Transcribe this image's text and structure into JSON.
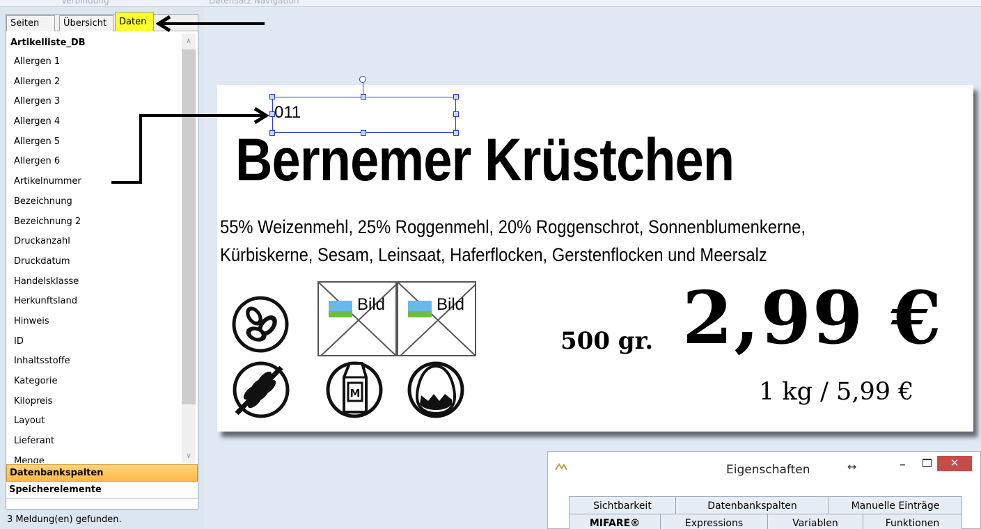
{
  "left_panel": {
    "tabs": [
      "Seiten",
      "Übersicht",
      "Daten"
    ],
    "database": "Artikelliste_DB",
    "fields": [
      "Allergen 1",
      "Allergen 2",
      "Allergen 3",
      "Allergen 4",
      "Allergen 5",
      "Allergen 6",
      "Artikelnummer",
      "Bezeichnung",
      "Bezeichnung 2",
      "Druckanzahl",
      "Druckdatum",
      "Handelsklasse",
      "Herkunftsland",
      "Hinweis",
      "ID",
      "Inhaltsstoffe",
      "Kategorie",
      "Kilopreis",
      "Layout",
      "Lieferant",
      "Menge"
    ],
    "sections": [
      "Datenbankspalten",
      "Speicherelemente"
    ]
  },
  "status": "3 Meldung(en) gefunden.",
  "label": {
    "article_number": "011",
    "product_name": "Bernemer Krüstchen",
    "ingredients_line1": "55% Weizenmehl, 25% Roggenmehl, 20% Roggenschrot, Sonnenblumenkerne,",
    "ingredients_line2": "Kürbiskerne, Sesam, Leinsaat, Haferflocken, Gerstenflocken und Meersalz",
    "weight": "500 gr.",
    "price": "2,99 €",
    "kilo_price": "1 kg / 5,99 €",
    "placeholder_text": "Bild",
    "icons": [
      "seeds-icon",
      "gluten-icon",
      "milk-icon",
      "egg-icon"
    ]
  },
  "properties": {
    "title": "Eigenschaften",
    "close": "✕",
    "tabs_row1": [
      "Sichtbarkeit",
      "Datenbankspalten",
      "Manuelle Einträge"
    ],
    "tabs_row2": [
      "MIFARE®",
      "Expressions",
      "Variablen",
      "Funktionen"
    ]
  },
  "colors": {
    "highlight_tab": "#fbff2a",
    "selection": "#2a3bd1",
    "active_section": "#ffc55e",
    "close_button": "#c84b47"
  }
}
